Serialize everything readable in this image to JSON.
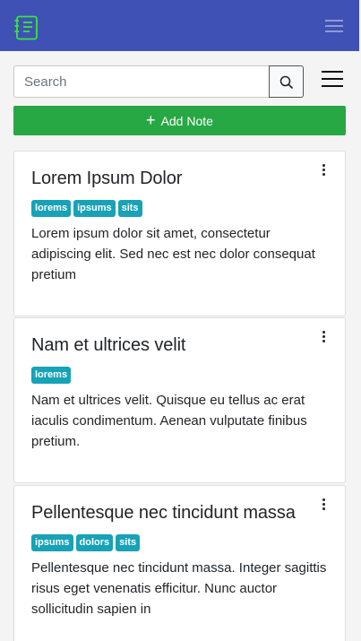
{
  "navbar": {
    "logo_icon": "notepad-icon",
    "toggle_icon": "hamburger-icon",
    "brand_color": "#3f51b5",
    "logo_color": "#39e639"
  },
  "search": {
    "placeholder": "Search",
    "button_icon": "search-icon",
    "menu_icon": "hamburger-icon"
  },
  "add_note": {
    "label": "Add Note",
    "icon": "plus-icon",
    "color": "#28a745"
  },
  "notes": [
    {
      "title": "Lorem Ipsum Dolor",
      "tags": [
        "lorems",
        "ipsums",
        "sits"
      ],
      "body": "Lorem ipsum dolor sit amet, consectetur adipiscing elit. Sed nec est nec dolor consequat pretium"
    },
    {
      "title": "Nam et ultrices velit",
      "tags": [
        "lorems"
      ],
      "body": "Nam et ultrices velit. Quisque eu tellus ac erat iaculis condimentum. Aenean vulputate finibus pretium."
    },
    {
      "title": "Pellentesque nec tincidunt massa",
      "tags": [
        "ipsums",
        "dolors",
        "sits"
      ],
      "body": "Pellentesque nec tincidunt massa. Integer sagittis risus eget venenatis efficitur. Nunc auctor sollicitudin sapien in"
    }
  ],
  "tag_color": "#17a2b8"
}
